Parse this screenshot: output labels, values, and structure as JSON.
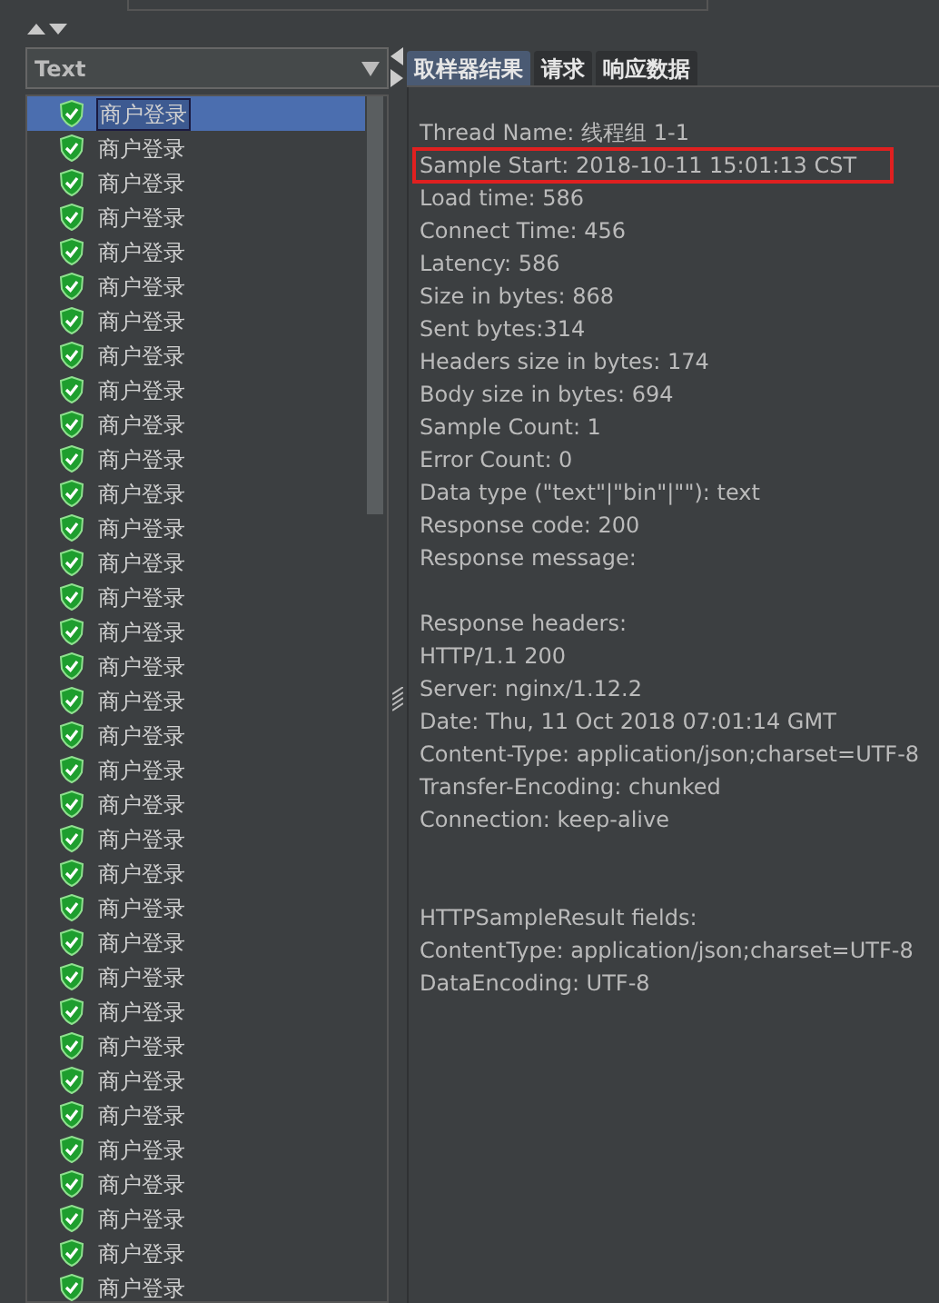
{
  "result_list": {
    "filter": "Text",
    "items": [
      {
        "label": "商户登录",
        "selected": true
      },
      {
        "label": "商户登录",
        "selected": false
      },
      {
        "label": "商户登录",
        "selected": false
      },
      {
        "label": "商户登录",
        "selected": false
      },
      {
        "label": "商户登录",
        "selected": false
      },
      {
        "label": "商户登录",
        "selected": false
      },
      {
        "label": "商户登录",
        "selected": false
      },
      {
        "label": "商户登录",
        "selected": false
      },
      {
        "label": "商户登录",
        "selected": false
      },
      {
        "label": "商户登录",
        "selected": false
      },
      {
        "label": "商户登录",
        "selected": false
      },
      {
        "label": "商户登录",
        "selected": false
      },
      {
        "label": "商户登录",
        "selected": false
      },
      {
        "label": "商户登录",
        "selected": false
      },
      {
        "label": "商户登录",
        "selected": false
      },
      {
        "label": "商户登录",
        "selected": false
      },
      {
        "label": "商户登录",
        "selected": false
      },
      {
        "label": "商户登录",
        "selected": false
      },
      {
        "label": "商户登录",
        "selected": false
      },
      {
        "label": "商户登录",
        "selected": false
      },
      {
        "label": "商户登录",
        "selected": false
      },
      {
        "label": "商户登录",
        "selected": false
      },
      {
        "label": "商户登录",
        "selected": false
      },
      {
        "label": "商户登录",
        "selected": false
      },
      {
        "label": "商户登录",
        "selected": false
      },
      {
        "label": "商户登录",
        "selected": false
      },
      {
        "label": "商户登录",
        "selected": false
      },
      {
        "label": "商户登录",
        "selected": false
      },
      {
        "label": "商户登录",
        "selected": false
      },
      {
        "label": "商户登录",
        "selected": false
      },
      {
        "label": "商户登录",
        "selected": false
      },
      {
        "label": "商户登录",
        "selected": false
      },
      {
        "label": "商户登录",
        "selected": false
      },
      {
        "label": "商户登录",
        "selected": false
      },
      {
        "label": "商户登录",
        "selected": false
      }
    ]
  },
  "tabs": [
    {
      "label": "取样器结果",
      "selected": true
    },
    {
      "label": "请求",
      "selected": false
    },
    {
      "label": "响应数据",
      "selected": false
    }
  ],
  "result_lines": [
    {
      "kind": "text",
      "text": "Thread Name: 线程组 1-1",
      "highlighted": false
    },
    {
      "kind": "text",
      "text": "Sample Start: 2018-10-11 15:01:13 CST",
      "highlighted": true
    },
    {
      "kind": "text",
      "text": "Load time: 586",
      "highlighted": false
    },
    {
      "kind": "text",
      "text": "Connect Time: 456",
      "highlighted": false
    },
    {
      "kind": "text",
      "text": "Latency: 586",
      "highlighted": false
    },
    {
      "kind": "text",
      "text": "Size in bytes: 868",
      "highlighted": false
    },
    {
      "kind": "text",
      "text": "Sent bytes:314",
      "highlighted": false
    },
    {
      "kind": "text",
      "text": "Headers size in bytes: 174",
      "highlighted": false
    },
    {
      "kind": "text",
      "text": "Body size in bytes: 694",
      "highlighted": false
    },
    {
      "kind": "text",
      "text": "Sample Count: 1",
      "highlighted": false
    },
    {
      "kind": "text",
      "text": "Error Count: 0",
      "highlighted": false
    },
    {
      "kind": "text",
      "text": "Data type (\"text\"|\"bin\"|\"\"): text",
      "highlighted": false
    },
    {
      "kind": "text",
      "text": "Response code: 200",
      "highlighted": false
    },
    {
      "kind": "text",
      "text": "Response message:",
      "highlighted": false
    },
    {
      "kind": "blank"
    },
    {
      "kind": "text",
      "text": "Response headers:",
      "highlighted": false
    },
    {
      "kind": "text",
      "text": "HTTP/1.1 200",
      "highlighted": false
    },
    {
      "kind": "text",
      "text": "Server: nginx/1.12.2",
      "highlighted": false
    },
    {
      "kind": "text",
      "text": "Date: Thu, 11 Oct 2018 07:01:14 GMT",
      "highlighted": false
    },
    {
      "kind": "text",
      "text": "Content-Type: application/json;charset=UTF-8",
      "highlighted": false
    },
    {
      "kind": "text",
      "text": "Transfer-Encoding: chunked",
      "highlighted": false
    },
    {
      "kind": "text",
      "text": "Connection: keep-alive",
      "highlighted": false
    },
    {
      "kind": "blank"
    },
    {
      "kind": "blank"
    },
    {
      "kind": "text",
      "text": "HTTPSampleResult fields:",
      "highlighted": false
    },
    {
      "kind": "text",
      "text": "ContentType: application/json;charset=UTF-8",
      "highlighted": false
    },
    {
      "kind": "text",
      "text": "DataEncoding: UTF-8",
      "highlighted": false
    }
  ]
}
